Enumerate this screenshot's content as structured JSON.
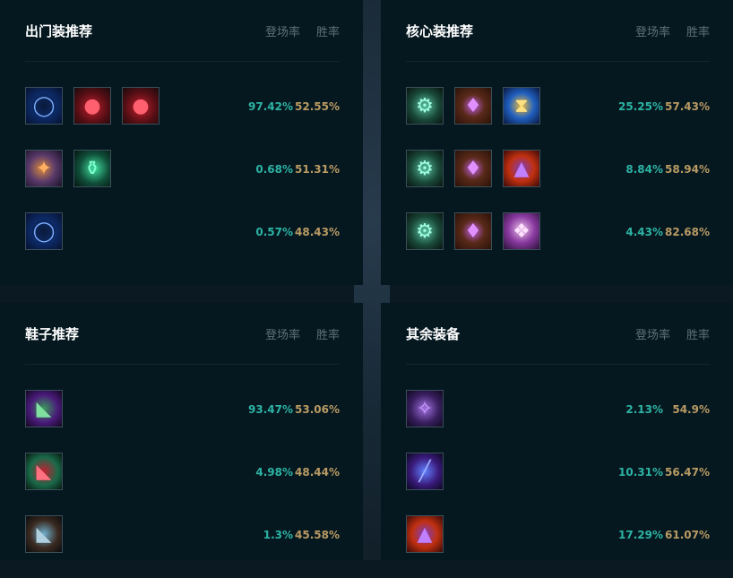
{
  "panels": {
    "starter": {
      "title": "出门装推荐",
      "col_pick": "登场率",
      "col_win": "胜率",
      "rows": [
        {
          "items": [
            "sapphire-ring-icon",
            "health-potion-icon",
            "health-potion-icon"
          ],
          "pick": "97.42%",
          "win": "52.55%"
        },
        {
          "items": [
            "guardian-horn-icon",
            "refillable-flask-icon"
          ],
          "pick": "0.68%",
          "win": "51.31%"
        },
        {
          "items": [
            "sapphire-ring-icon"
          ],
          "pick": "0.57%",
          "win": "48.43%"
        }
      ]
    },
    "core": {
      "title": "核心装推荐",
      "col_pick": "登场率",
      "col_win": "胜率",
      "rows": [
        {
          "items": [
            "hextech-gunblade-icon",
            "demon-mask-icon",
            "hourglass-icon"
          ],
          "pick": "25.25%",
          "win": "57.43%"
        },
        {
          "items": [
            "hextech-gunblade-icon",
            "demon-mask-icon",
            "wizard-hat-icon"
          ],
          "pick": "8.84%",
          "win": "58.94%"
        },
        {
          "items": [
            "hextech-gunblade-icon",
            "demon-mask-icon",
            "spellbook-icon"
          ],
          "pick": "4.43%",
          "win": "82.68%"
        }
      ]
    },
    "boots": {
      "title": "鞋子推荐",
      "col_pick": "登场率",
      "col_win": "胜率",
      "rows": [
        {
          "items": [
            "sorcerer-boots-icon"
          ],
          "pick": "93.47%",
          "win": "53.06%"
        },
        {
          "items": [
            "mercury-boots-icon"
          ],
          "pick": "4.98%",
          "win": "48.44%"
        },
        {
          "items": [
            "steel-boots-icon"
          ],
          "pick": "1.3%",
          "win": "45.58%"
        }
      ]
    },
    "other": {
      "title": "其余装备",
      "col_pick": "登场率",
      "col_win": "胜率",
      "rows": [
        {
          "items": [
            "void-staff-icon"
          ],
          "pick": "2.13%",
          "win": "54.9%"
        },
        {
          "items": [
            "morello-staff-icon"
          ],
          "pick": "10.31%",
          "win": "56.47%"
        },
        {
          "items": [
            "wizard-hat-icon"
          ],
          "pick": "17.29%",
          "win": "61.07%"
        }
      ]
    }
  }
}
